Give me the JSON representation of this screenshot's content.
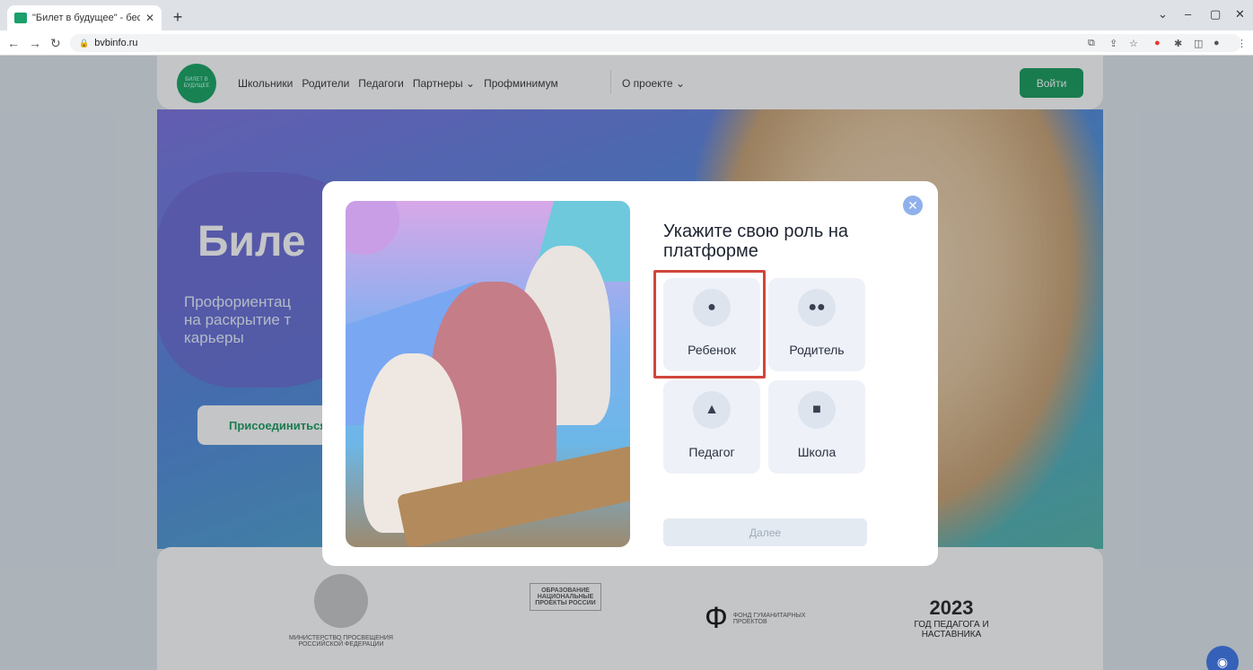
{
  "browser": {
    "tab_title": "\"Билет в будущее\" - бесплатна",
    "tab_close": "✕",
    "new_tab": "+",
    "url": "bvbinfo.ru",
    "window_controls": [
      "⌄",
      "–",
      "▢",
      "✕"
    ]
  },
  "header": {
    "logo_text": "БИЛЕТ В БУДУЩЕЕ",
    "nav": [
      "Школьники",
      "Родители",
      "Педагоги",
      "Партнеры ⌄",
      "Профминимум"
    ],
    "nav_about": "О проекте ⌄",
    "login": "Войти"
  },
  "hero": {
    "title": "Биле",
    "subtitle": "Профориентац\nна раскрытие т\nкарьеры",
    "join": "Присоединиться"
  },
  "partners": {
    "ministry": "МИНИСТЕРСТВО ПРОСВЕЩЕНИЯ РОССИЙСКОЙ ФЕДЕРАЦИИ",
    "national": "ОБРАЗОВАНИЕ НАЦИОНАЛЬНЫЕ ПРОЕКТЫ РОССИИ",
    "fund": "ФОНД ГУМАНИТАРНЫХ ПРОЕКТОВ",
    "year_num": "2023",
    "year": "ГОД ПЕДАГОГА И НАСТАВНИКА"
  },
  "modal": {
    "title": "Укажите свою роль на платформе",
    "close": "✕",
    "roles": [
      {
        "label": "Ребенок",
        "icon": "person-icon",
        "selected": true
      },
      {
        "label": "Родитель",
        "icon": "users-icon",
        "selected": false
      },
      {
        "label": "Педагог",
        "icon": "graduation-cap-icon",
        "selected": false
      },
      {
        "label": "Школа",
        "icon": "briefcase-icon",
        "selected": false
      }
    ],
    "next": "Далее"
  },
  "colors": {
    "brand_green": "#139a58",
    "selection_red": "#d0453c"
  }
}
